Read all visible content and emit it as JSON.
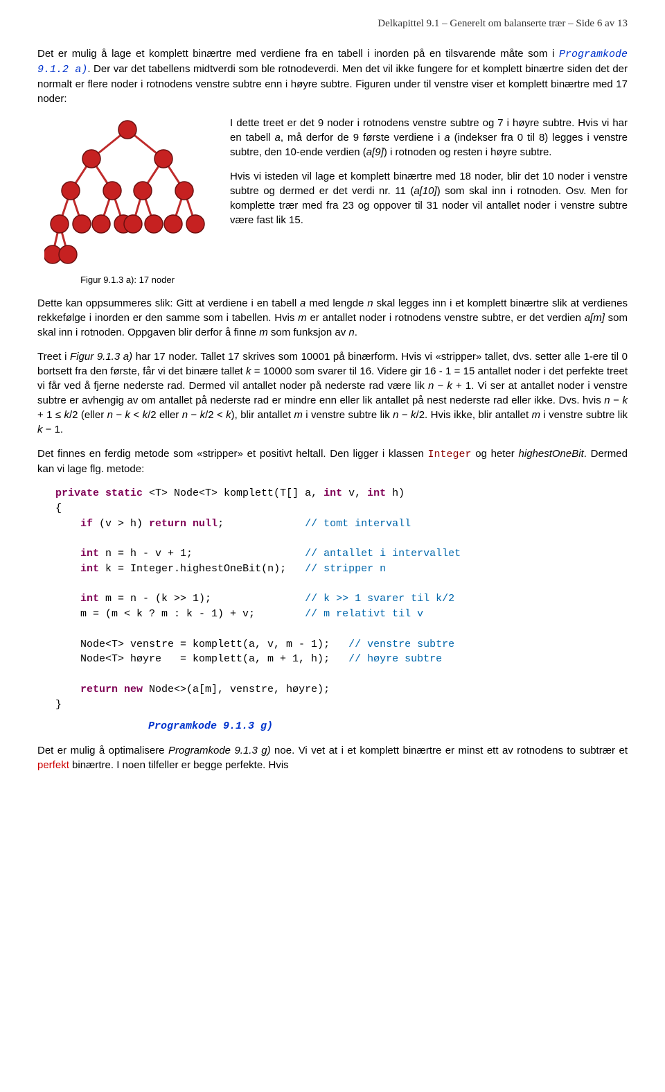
{
  "header": "Delkapittel 9.1 – Generelt om balanserte trær – Side 6 av 13",
  "p1a": "Det er mulig å lage et komplett binærtre med verdiene fra en tabell i inorden på en tilsvarende måte som i ",
  "p1b": "Programkode 9.1.2 a)",
  "p1c": ". Der var det tabellens midtverdi som ble rotnodeverdi. Men det vil ikke fungere for et komplett binærtre siden det der normalt er flere noder i rotnodens venstre subtre enn i høyre subtre. Figuren under til venstre viser et komplett binærtre med 17 noder:",
  "beside1a": "I dette treet er det 9 noder i rotnodens venstre subtre og 7 i høyre subtre. Hvis vi har en tabell ",
  "beside1b": "a",
  "beside1c": ", må derfor de 9 første verdiene i ",
  "beside1d": "a",
  "beside1e": " (indekser fra 0 til 8) legges i venstre subtre, den 10-ende verdien (",
  "beside1f": "a[9]",
  "beside1g": ") i rotnoden og resten i høyre subtre.",
  "beside2a": "Hvis vi isteden vil lage et komplett binærtre med 18 noder, blir det 10 noder i venstre subtre og dermed er det verdi nr. 11 (",
  "beside2b": "a[10]",
  "beside2c": ") som skal inn i rotnoden. Osv. Men for komplette trær med fra 23 og oppover til 31 noder vil antallet noder i venstre subtre være fast lik 15.",
  "figcap": "Figur 9.1.3 a): 17 noder",
  "p2a": "Dette kan oppsummeres slik: Gitt at verdiene i en tabell ",
  "p2b": "a",
  "p2c": " med lengde ",
  "p2d": "n",
  "p2e": " skal legges inn i et komplett binærtre slik at verdienes rekkefølge i inorden er den samme som i tabellen. Hvis ",
  "p2f": "m",
  "p2g": " er antallet noder i rotnodens venstre subtre, er det verdien ",
  "p2h": "a[m]",
  "p2i": " som skal inn i rotnoden. Oppgaven blir derfor å finne ",
  "p2j": "m",
  "p2k": " som funksjon av ",
  "p2l": "n",
  "p2m": ".",
  "p3a": "Treet i ",
  "p3b": "Figur 9.1.3 a)",
  "p3c": " har 17 noder. Tallet 17 skrives som 10001 på binærform. Hvis vi «stripper» tallet, dvs. setter alle 1-ere til 0 bortsett fra den første, får vi det binære tallet ",
  "p3d": "k",
  "p3e": " = 10000 som svarer til 16. Videre gir 16 - 1 = 15 antallet noder i det perfekte treet vi får ved å fjerne nederste rad. Dermed vil antallet noder på nederste rad være lik ",
  "p3f": "n",
  "p3g": " − ",
  "p3h": "k",
  "p3i": " + 1. Vi ser at antallet noder i venstre subtre er avhengig av om antallet på nederste rad er mindre enn eller lik antallet på nest nederste rad eller ikke. Dvs. hvis ",
  "p3j": "n",
  "p3k": " − ",
  "p3l": "k",
  "p3m": " + 1 ≤ ",
  "p3n": "k",
  "p3o": "/2 (eller ",
  "p3p": "n",
  "p3q": " − ",
  "p3r": "k",
  "p3s": " < ",
  "p3t": "k",
  "p3u": "/2 eller ",
  "p3v": "n",
  "p3w": " − ",
  "p3x": "k",
  "p3y": "/2 < ",
  "p3z": "k",
  "p3aa": "), blir antallet ",
  "p3ab": "m",
  "p3ac": " i venstre subtre lik ",
  "p3ad": "n",
  "p3ae": " − ",
  "p3af": "k",
  "p3ag": "/2. Hvis ikke, blir antallet ",
  "p3ah": "m",
  "p3ai": " i venstre subtre lik ",
  "p3aj": "k",
  "p3ak": " − 1.",
  "p4a": "Det finnes en ferdig metode som «stripper» et positivt heltall. Den ligger i klassen ",
  "p4b": "Integer",
  "p4c": " og heter ",
  "p4d": "highestOneBit",
  "p4e": ". Dermed kan vi lage flg. metode:",
  "code": {
    "l1": "private static <T> Node<T> komplett(T[] a, int v, int h)",
    "l2": "{",
    "l3": "    if (v > h) return null;             // tomt intervall",
    "l5": "    int n = h - v + 1;                  // antallet i intervallet",
    "l6": "    int k = Integer.highestOneBit(n);   // stripper n",
    "l8": "    int m = n - (k >> 1);               // k >> 1 svarer til k/2",
    "l9": "    m = (m < k ? m : k - 1) + v;        // m relativt til v",
    "l11": "    Node<T> venstre = komplett(a, v, m - 1);   // venstre subtre",
    "l12": "    Node<T> høyre   = komplett(a, m + 1, h);   // høyre subtre",
    "l14": "    return new Node<>(a[m], venstre, høyre);",
    "l15": "}"
  },
  "codelabel": "Programkode 9.1.3 g)",
  "p5a": "Det er mulig å optimalisere ",
  "p5b": "Programkode 9.1.3 g)",
  "p5c": " noe. Vi vet at i et komplett binærtre er minst ett av rotnodens to subtrær et ",
  "p5d": "perfekt",
  "p5e": " binærtre. I noen tilfeller er begge perfekte. Hvis"
}
